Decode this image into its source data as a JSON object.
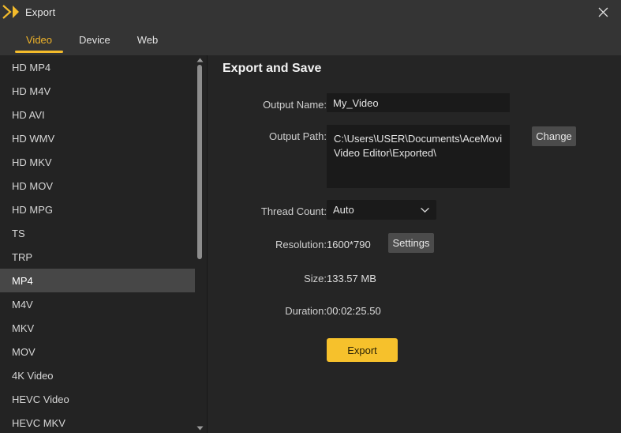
{
  "window": {
    "title": "Export",
    "app_icon": "acemovi-logo-icon",
    "close_label": "×"
  },
  "tabs": [
    {
      "label": "Video",
      "active": true
    },
    {
      "label": "Device",
      "active": false
    },
    {
      "label": "Web",
      "active": false
    }
  ],
  "sidebar": {
    "scrollbar": {
      "up_arrow": "chevron-up-icon",
      "down_arrow": "chevron-down-icon"
    },
    "formats": [
      {
        "label": "HD MP4",
        "selected": false
      },
      {
        "label": "HD M4V",
        "selected": false
      },
      {
        "label": "HD AVI",
        "selected": false
      },
      {
        "label": "HD WMV",
        "selected": false
      },
      {
        "label": "HD MKV",
        "selected": false
      },
      {
        "label": "HD MOV",
        "selected": false
      },
      {
        "label": "HD MPG",
        "selected": false
      },
      {
        "label": "TS",
        "selected": false
      },
      {
        "label": "TRP",
        "selected": false
      },
      {
        "label": "MP4",
        "selected": true
      },
      {
        "label": "M4V",
        "selected": false
      },
      {
        "label": "MKV",
        "selected": false
      },
      {
        "label": "MOV",
        "selected": false
      },
      {
        "label": "4K Video",
        "selected": false
      },
      {
        "label": "HEVC Video",
        "selected": false
      },
      {
        "label": "HEVC MKV",
        "selected": false
      }
    ]
  },
  "main": {
    "heading": "Export and Save",
    "output_name": {
      "label": "Output Name:",
      "value": "My_Video"
    },
    "output_path": {
      "label": "Output Path:",
      "value": "C:\\Users\\USER\\Documents\\AceMovi Video Editor\\Exported\\",
      "change_button": "Change"
    },
    "thread_count": {
      "label": "Thread Count:",
      "value": "Auto",
      "chevron": "chevron-down-icon"
    },
    "resolution": {
      "label": "Resolution:",
      "value": "1600*790",
      "settings_button": "Settings"
    },
    "size": {
      "label": "Size:",
      "value": "133.57 MB"
    },
    "duration": {
      "label": "Duration:",
      "value": "00:02:25.50"
    },
    "export_button": "Export"
  },
  "colors": {
    "accent": "#f6c12c",
    "titlebar": "#343434",
    "sidebar": "#232323",
    "panel": "#252525",
    "input": "#1a1a1a",
    "selected_row": "#474747"
  }
}
